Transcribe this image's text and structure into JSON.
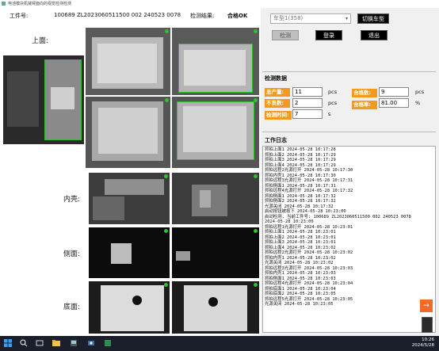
{
  "window": {
    "title": "电池模块机械臂面向的视觉检测检测"
  },
  "header": {
    "work_no_label": "工件号:",
    "work_no_value": "100689 ZL2023060511500 002 240523 0078",
    "result_label": "检测结果:",
    "result_value": "合格OK"
  },
  "sections": {
    "top": "上面:",
    "inner": "内壳:",
    "side": "侧面:",
    "bottom": "底面:"
  },
  "controls": {
    "model_selected": "车型1(358)",
    "switch_model": "切换车型",
    "detect": "检测",
    "login": "登录",
    "exit": "退出"
  },
  "stats": {
    "title": "检测数据",
    "total_label": "总产量:",
    "total_value": "11",
    "total_unit": "pcs",
    "pass_label": "合格数:",
    "pass_value": "9",
    "pass_unit": "pcs",
    "fail_label": "不良数:",
    "fail_value": "2",
    "fail_unit": "pcs",
    "rate_label": "合格率:",
    "rate_value": "81.00",
    "rate_unit": "%",
    "time_label": "检测时间:",
    "time_value": "7",
    "time_unit": "s"
  },
  "log": {
    "title": "工作日志",
    "lines": [
      "抓拍上面1 2024-05-28 10:17:28",
      "抓拍上面2 2024-05-28 10:17:29",
      "抓拍上面3 2024-05-28 10:17:29",
      "抓拍上面4 2024-05-28 10:17:29",
      "抓拍远程2光源打开 2024-05-28 10:17:30",
      "抓拍内壳1 2024-05-28 10:17:30",
      "抓拍远程3光源打开 2024-05-28 10:17:31",
      "抓拍侧面1 2024-05-28 10:17:31",
      "抓拍远程4光源打开 2024-05-28 10:17:32",
      "抓拍侧面1 2024-05-28 10:17:32",
      "抓拍侧面2 2024-05-28 10:17:32",
      "光源关闭 2024-05-28 10:17:32",
      "启动按钮被按下 2024-05-28 10:23:00",
      "启动检测, 当前工件号: 100689 ZL2023060511500 002 240523 0078",
      "2024-05-28 10:23:00",
      "抓拍远程1光源打开 2024-05-28 10:23:01",
      "抓拍上面1 2024-05-28 10:23:01",
      "抓拍上面2 2024-05-28 10:23:01",
      "抓拍上面3 2024-05-28 10:23:01",
      "抓拍上面4 2024-05-28 10:23:02",
      "抓拍远程2光源打开 2024-05-28 10:23:02",
      "抓拍内壳1 2024-05-28 10:23:02",
      "光源关闭 2024-05-28 10:23:02",
      "抓拍远程3光源打开 2024-05-28 10:23:03",
      "抓拍内壳1 2024-05-28 10:23:03",
      "抓拍侧面1 2024-05-28 10:23:03",
      "抓拍远程4光源打开 2024-05-28 10:23:04",
      "抓拍底面1 2024-05-28 10:23:04",
      "抓拍底面2 2024-05-28 10:23:05",
      "抓拍远程5光源打开 2024-05-28 10:23:05",
      "光源关闭 2024-05-28 10:23:05"
    ]
  },
  "taskbar": {
    "time": "10:26",
    "date": "2024/5/28"
  },
  "colors": {
    "ok_green": "#2dbf2d",
    "stat_orange": "#f39a1e",
    "button_black": "#000000"
  }
}
